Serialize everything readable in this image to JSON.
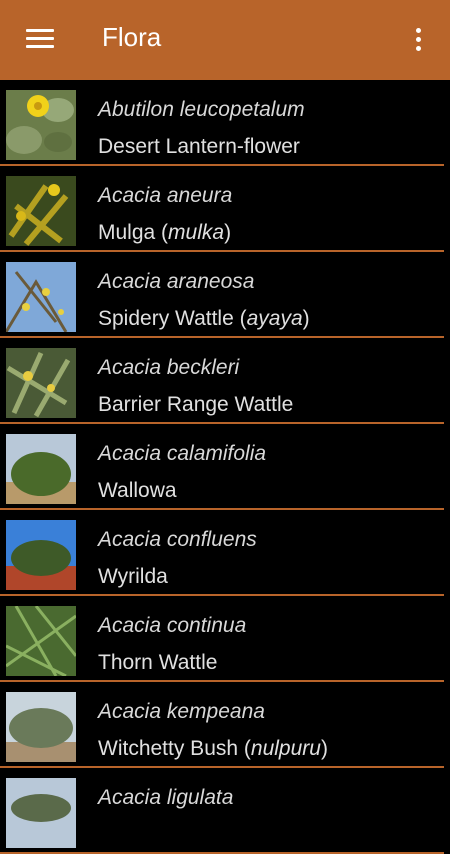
{
  "app": {
    "title": "Flora"
  },
  "icons": {
    "menu": "hamburger-menu-icon",
    "more": "more-vert-icon"
  },
  "colors": {
    "accent": "#b8642a",
    "background": "#000000"
  },
  "items": [
    {
      "sci": "Abutilon leucopetalum",
      "common_pre": "Desert Lantern-flower",
      "common_it": "",
      "common_post": ""
    },
    {
      "sci": "Acacia aneura",
      "common_pre": "Mulga (",
      "common_it": "mulka",
      "common_post": ")"
    },
    {
      "sci": "Acacia araneosa",
      "common_pre": "Spidery Wattle (",
      "common_it": "ayaya",
      "common_post": ")"
    },
    {
      "sci": "Acacia beckleri",
      "common_pre": "Barrier Range Wattle",
      "common_it": "",
      "common_post": ""
    },
    {
      "sci": "Acacia calamifolia",
      "common_pre": "Wallowa",
      "common_it": "",
      "common_post": ""
    },
    {
      "sci": "Acacia confluens",
      "common_pre": "Wyrilda",
      "common_it": "",
      "common_post": ""
    },
    {
      "sci": "Acacia continua",
      "common_pre": "Thorn Wattle",
      "common_it": "",
      "common_post": ""
    },
    {
      "sci": "Acacia kempeana",
      "common_pre": "Witchetty Bush (",
      "common_it": "nulpuru",
      "common_post": ")"
    },
    {
      "sci": "Acacia ligulata",
      "common_pre": "",
      "common_it": "",
      "common_post": ""
    }
  ]
}
